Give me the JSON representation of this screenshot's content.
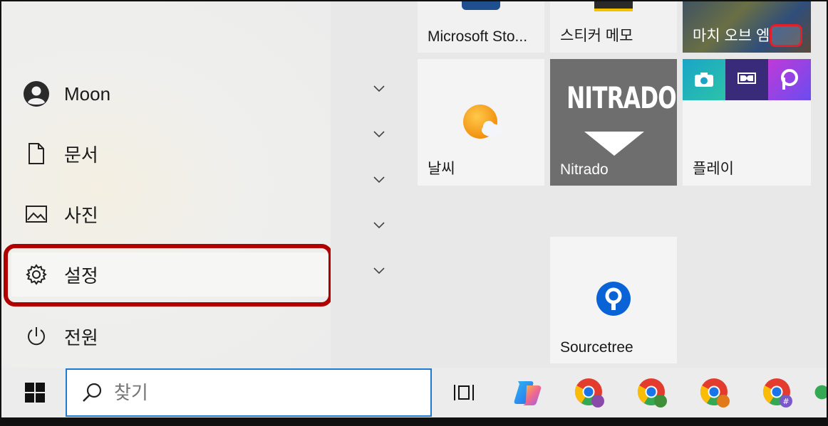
{
  "start_menu": {
    "nav": [
      {
        "label": "Moon",
        "icon": "user-avatar-icon"
      },
      {
        "label": "문서",
        "icon": "document-icon"
      },
      {
        "label": "사진",
        "icon": "pictures-icon"
      },
      {
        "label": "설정",
        "icon": "gear-icon"
      },
      {
        "label": "전원",
        "icon": "power-icon"
      }
    ]
  },
  "tiles": {
    "microsoft_store": "Microsoft Sto...",
    "sticky_notes": "스티커 메모",
    "age_of_empires": "마치 오브 엠",
    "weather": "날씨",
    "nitrado_logo": "NITRADO",
    "nitrado": "Nitrado",
    "play": "플레이",
    "sourcetree": "Sourcetree"
  },
  "taskbar": {
    "search_placeholder": "찾기"
  },
  "colors": {
    "highlight": "#b00000",
    "search_border": "#1f7ad1",
    "nitrado_bg": "#6e6e6e",
    "sourcetree_blue": "#0a63d6"
  }
}
